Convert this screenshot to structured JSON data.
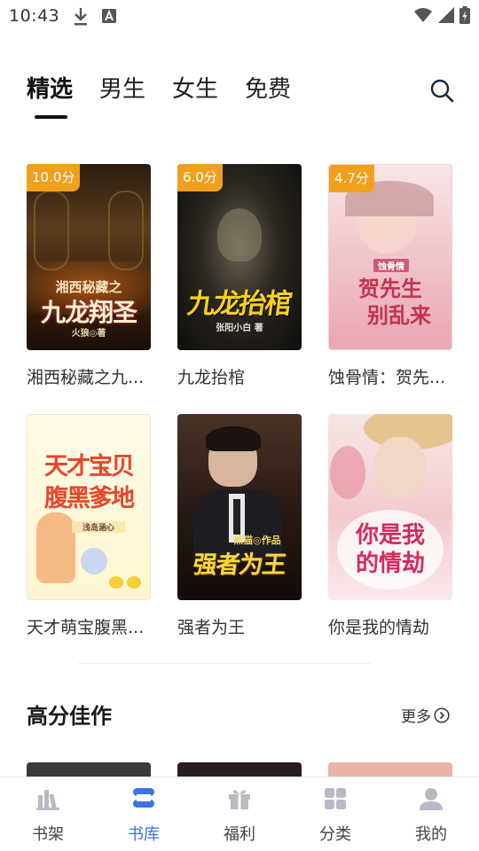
{
  "status_bar": {
    "time": "10:43",
    "icons": [
      "download-icon",
      "a-notification-icon",
      "wifi-icon",
      "signal-icon",
      "battery-icon"
    ]
  },
  "top_tabs": [
    {
      "label": "精选",
      "active": true
    },
    {
      "label": "男生",
      "active": false
    },
    {
      "label": "女生",
      "active": false
    },
    {
      "label": "免费",
      "active": false
    }
  ],
  "books": [
    {
      "score": "10.0分",
      "title": "湘西秘藏之九...",
      "cover_title": "湘西秘藏之",
      "cover_big": "九龙翔圣",
      "cover_author": "火狼◎著"
    },
    {
      "score": "6.0分",
      "title": "九龙抬棺",
      "cover_big": "九龙抬棺",
      "cover_author": "张阳小白 著"
    },
    {
      "score": "4.7分",
      "title": "蚀骨情：贺先...",
      "cover_small": "蚀骨情",
      "cover_big": "贺先生",
      "cover_big2": "别乱来"
    },
    {
      "title": "天才萌宝腹黑...",
      "cover_big": "天才宝贝",
      "cover_big2": "腹黑爹地",
      "cover_author": "浅岛涵心"
    },
    {
      "title": "强者为王",
      "cover_small": "熊猫◎作品",
      "cover_big": "强者为王"
    },
    {
      "title": "你是我的情劫",
      "cover_big": "你是我",
      "cover_big2": "的情劫"
    }
  ],
  "section": {
    "title": "高分佳作",
    "more": "更多"
  },
  "nav": [
    {
      "label": "书架",
      "icon": "bookshelf-icon",
      "active": false
    },
    {
      "label": "书库",
      "icon": "library-icon",
      "active": true
    },
    {
      "label": "福利",
      "icon": "gift-icon",
      "active": false
    },
    {
      "label": "分类",
      "icon": "category-grid-icon",
      "active": false
    },
    {
      "label": "我的",
      "icon": "profile-icon",
      "active": false
    }
  ],
  "colors": {
    "accent": "#3b73e6",
    "badge": "#f0a01c",
    "text": "#333333"
  }
}
